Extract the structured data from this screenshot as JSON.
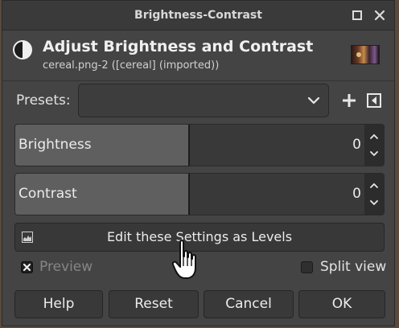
{
  "window": {
    "title": "Brightness-Contrast"
  },
  "header": {
    "title": "Adjust Brightness and Contrast",
    "subtitle": "cereal.png-2 ([cereal] (imported))"
  },
  "presets": {
    "label": "Presets:",
    "value": ""
  },
  "brightness": {
    "label": "Brightness",
    "value": "0",
    "fill_fraction": 0.47
  },
  "contrast": {
    "label": "Contrast",
    "value": "0",
    "fill_fraction": 0.47
  },
  "levels_button": {
    "label": "Edit these Settings as Levels"
  },
  "preview": {
    "label": "Preview",
    "checked": true
  },
  "split_view": {
    "label": "Split view",
    "checked": false
  },
  "buttons": {
    "help": "Help",
    "reset": "Reset",
    "cancel": "Cancel",
    "ok": "OK"
  },
  "icons": {
    "header": "brightness-contrast-icon",
    "preset_add": "plus-icon",
    "preset_menu": "menu-triangle-icon",
    "levels": "levels-icon",
    "cursor": "hand-pointer-cursor"
  }
}
